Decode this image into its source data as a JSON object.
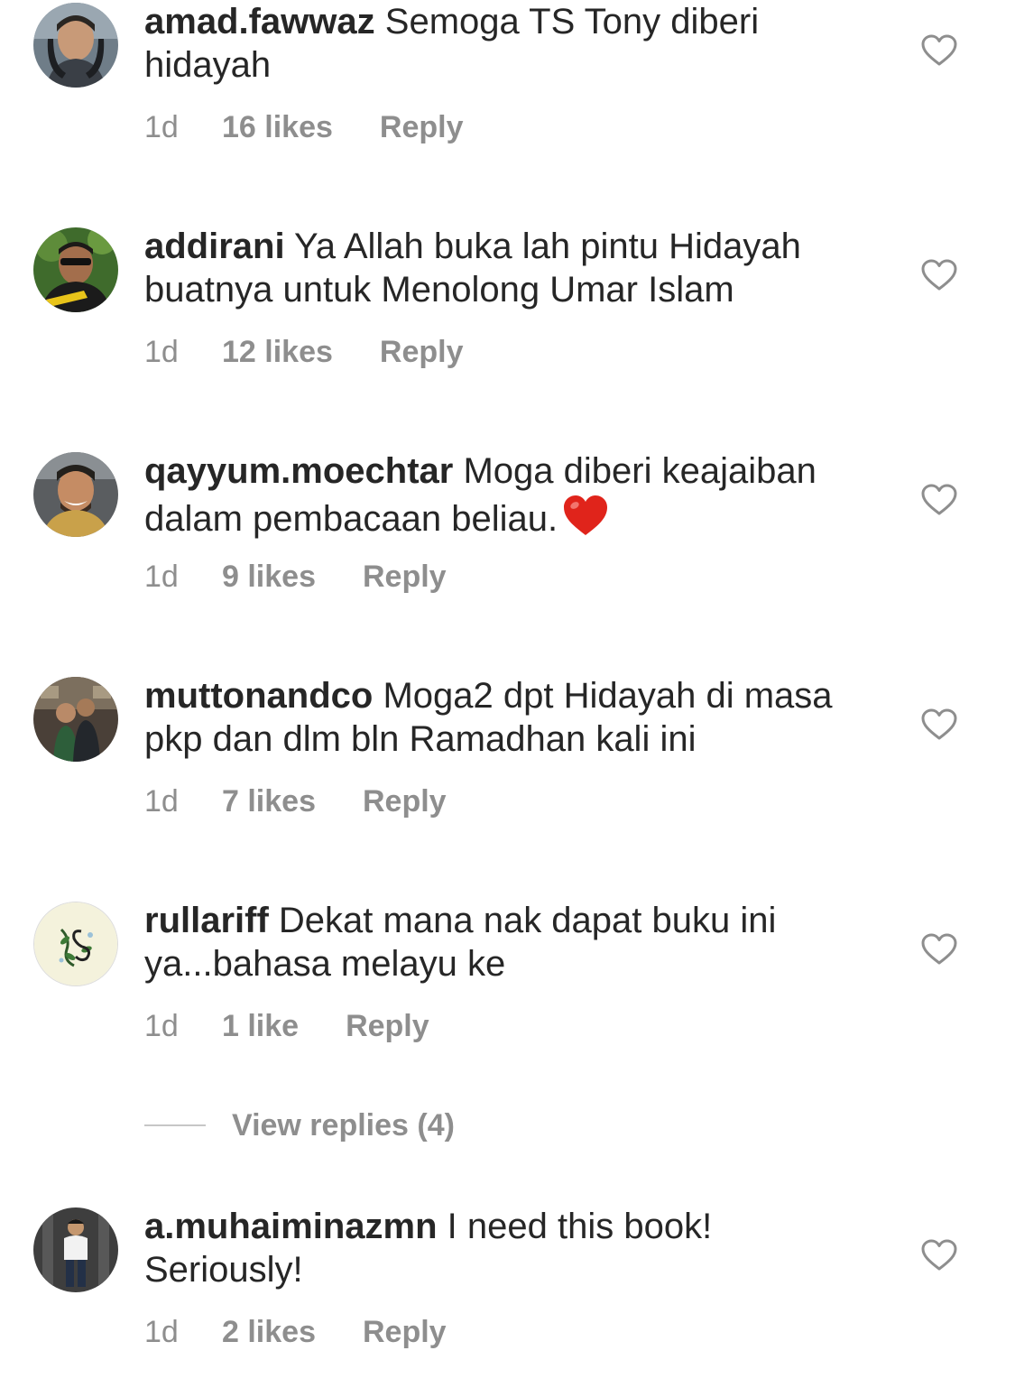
{
  "comments": [
    {
      "username": "amad.fawwaz",
      "text": "Semoga TS Tony diberi hidayah",
      "time": "1d",
      "likes": "16 likes",
      "reply": "Reply",
      "avatar_icon": "profile-photo-man-headphones"
    },
    {
      "username": "addirani",
      "text": "Ya Allah buka lah pintu Hidayah buatnya untuk Menolong Umar Islam",
      "time": "1d",
      "likes": "12 likes",
      "reply": "Reply",
      "avatar_icon": "profile-photo-man-sunglasses"
    },
    {
      "username": "qayyum.moechtar",
      "text": "Moga diberi keajaiban dalam pembacaan beliau.",
      "emoji": "red-heart-emoji",
      "time": "1d",
      "likes": "9 likes",
      "reply": "Reply",
      "avatar_icon": "profile-photo-man-smiling"
    },
    {
      "username": "muttonandco",
      "text": "Moga2 dpt Hidayah di masa pkp dan dlm bln Ramadhan kali ini",
      "time": "1d",
      "likes": "7 likes",
      "reply": "Reply",
      "avatar_icon": "profile-photo-couple"
    },
    {
      "username": "rullariff",
      "text": "Dekat mana nak dapat buku ini ya...bahasa melayu ke",
      "time": "1d",
      "likes": "1 like",
      "reply": "Reply",
      "avatar_icon": "profile-logo-monogram"
    },
    {
      "username": "a.muhaiminazmn",
      "text": "I need this book! Seriously!",
      "time": "1d",
      "likes": "2 likes",
      "reply": "Reply",
      "avatar_icon": "profile-photo-man-standing"
    }
  ],
  "view_replies": "View replies (4)",
  "icons": {
    "like": "heart-outline-icon"
  },
  "colors": {
    "text": "#262626",
    "secondary": "#8e8e8e",
    "divider": "#c7c7c7",
    "emoji_heart": "#e0241b"
  }
}
